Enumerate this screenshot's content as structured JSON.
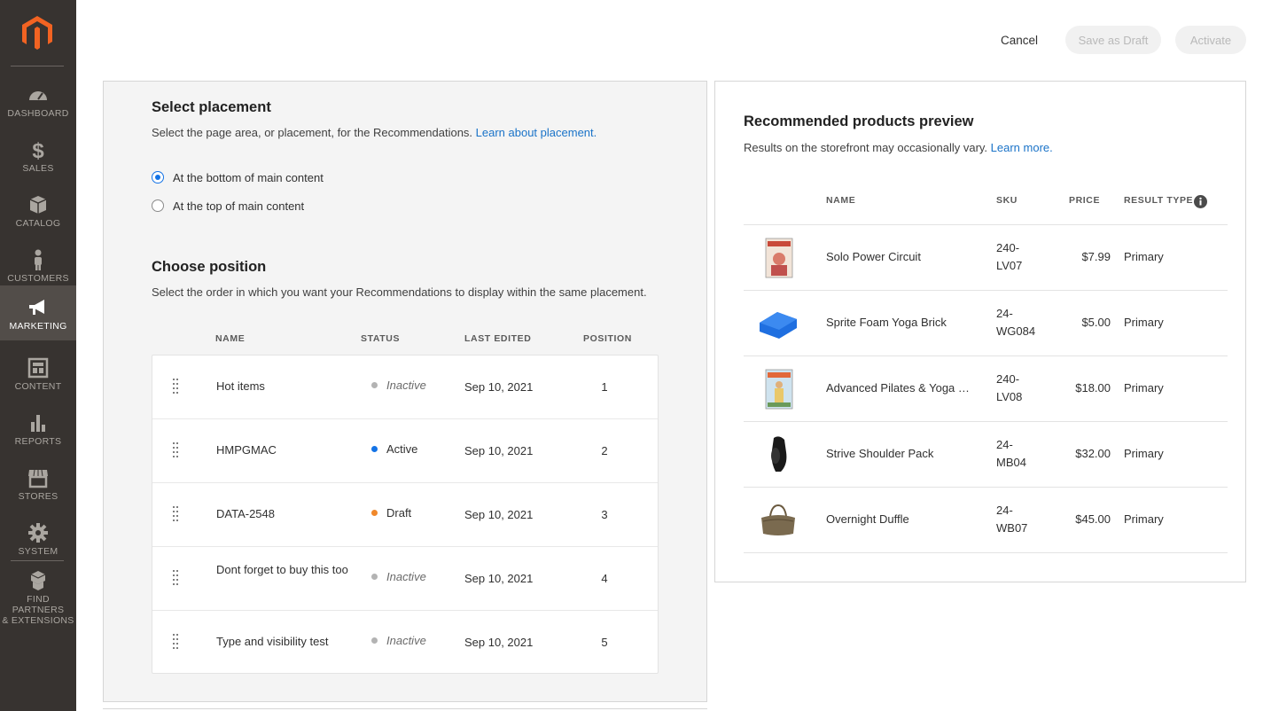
{
  "nav": [
    {
      "label": "DASHBOARD",
      "icon": "dashboard-icon"
    },
    {
      "label": "SALES",
      "icon": "dollar-icon"
    },
    {
      "label": "CATALOG",
      "icon": "catalog-box-icon"
    },
    {
      "label": "CUSTOMERS",
      "icon": "customer-person-icon"
    },
    {
      "label": "MARKETING",
      "icon": "megaphone-icon",
      "active": true
    },
    {
      "label": "CONTENT",
      "icon": "content-layout-icon"
    },
    {
      "label": "REPORTS",
      "icon": "bar-chart-icon"
    },
    {
      "label": "STORES",
      "icon": "storefront-icon"
    },
    {
      "label": "SYSTEM",
      "icon": "gear-icon"
    },
    {
      "label": "FIND PARTNERS & EXTENSIONS",
      "label_line1": "FIND PARTNERS",
      "label_line2": "& EXTENSIONS",
      "icon": "extensions-boxes-icon"
    }
  ],
  "header": {
    "cancel": "Cancel",
    "save_draft": "Save as Draft",
    "activate": "Activate"
  },
  "placement": {
    "title": "Select placement",
    "description": "Select the page area, or placement, for the Recommendations. ",
    "link": "Learn about placement.",
    "options": [
      {
        "label": "At the bottom of main content",
        "checked": true
      },
      {
        "label": "At the top of main content",
        "checked": false
      }
    ]
  },
  "position": {
    "title": "Choose position",
    "description": "Select the order in which you want your Recommendations to display within the same placement.",
    "columns": {
      "name": "NAME",
      "status": "STATUS",
      "last_edited": "LAST EDITED",
      "position": "POSITION"
    },
    "rows": [
      {
        "name": "Hot items",
        "status": "Inactive",
        "date": "Sep 10, 2021",
        "position": "1"
      },
      {
        "name": "HMPGMAC",
        "status": "Active",
        "date": "Sep 10, 2021",
        "position": "2"
      },
      {
        "name": "DATA-2548",
        "status": "Draft",
        "date": "Sep 10, 2021",
        "position": "3"
      },
      {
        "name": "Dont forget to buy this too",
        "status": "Inactive",
        "date": "Sep 10, 2021",
        "position": "4"
      },
      {
        "name": "Type and visibility test",
        "status": "Inactive",
        "date": "Sep 10, 2021",
        "position": "5"
      }
    ],
    "status_colors": {
      "Inactive": "#b3b3b3",
      "Active": "#1473e6",
      "Draft": "#f0882b"
    }
  },
  "preview": {
    "title": "Recommended products preview",
    "description": "Results on the storefront may occasionally vary. ",
    "link": "Learn more.",
    "columns": {
      "name": "NAME",
      "sku": "SKU",
      "price": "PRICE",
      "result_type": "RESULT TYPE"
    },
    "products": [
      {
        "name": "Solo Power Circuit",
        "sku_line1": "240-",
        "sku_line2": "LV07",
        "price": "$7.99",
        "type": "Primary"
      },
      {
        "name": "Sprite Foam Yoga Brick",
        "sku_line1": "24-",
        "sku_line2": "WG084",
        "price": "$5.00",
        "type": "Primary"
      },
      {
        "name": "Advanced Pilates & Yoga (…",
        "sku_line1": "240-",
        "sku_line2": "LV08",
        "price": "$18.00",
        "type": "Primary"
      },
      {
        "name": "Strive Shoulder Pack",
        "sku_line1": "24-",
        "sku_line2": "MB04",
        "price": "$32.00",
        "type": "Primary"
      },
      {
        "name": "Overnight Duffle",
        "sku_line1": "24-",
        "sku_line2": "WB07",
        "price": "$45.00",
        "type": "Primary"
      }
    ]
  }
}
